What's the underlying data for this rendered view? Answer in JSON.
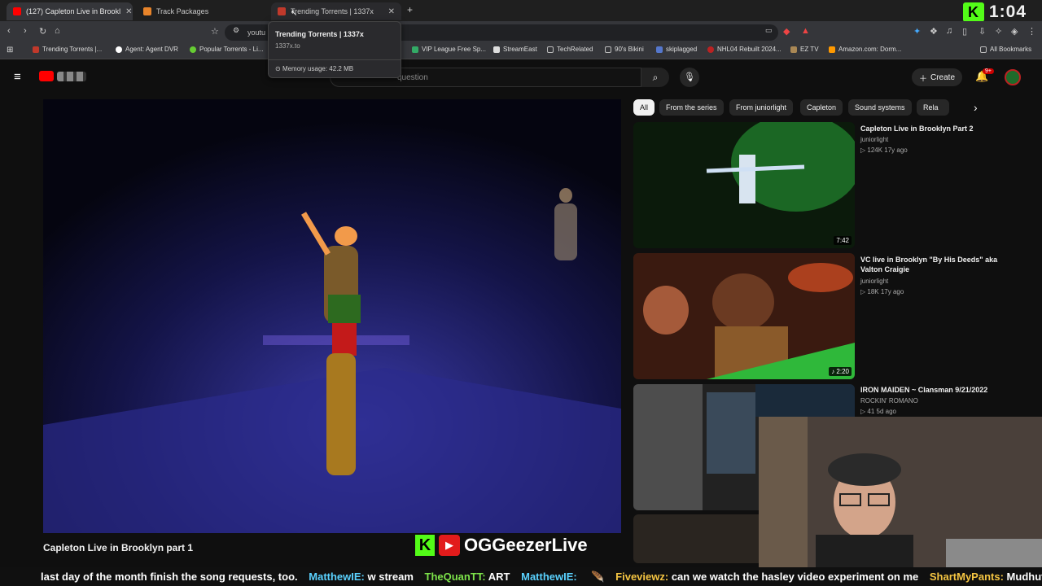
{
  "browser": {
    "tabs": [
      {
        "title": "(127) Capleton Live in Brookl",
        "active": true
      },
      {
        "title": "Track Packages",
        "active": false
      },
      {
        "title": "Trending Torrents | 1337x",
        "active": false
      }
    ],
    "new_tab": "+",
    "address": "youtu",
    "tooltip": {
      "title": "Trending Torrents | 1337x",
      "domain": "1337x.to",
      "memory": "Memory usage: 42.2 MB"
    },
    "bookmarks": [
      "Trending Torrents |...",
      "Agent: Agent DVR",
      "Popular Torrents - Li...",
      "VIP League Free Sp...",
      "StreamEast",
      "TechRelated",
      "90's Bikini",
      "skiplagged",
      "NHL04 Rebuilt 2024...",
      "EZ TV",
      "Amazon.com: Dorm...",
      "All Bookmarks"
    ]
  },
  "youtube": {
    "search_placeholder": "question",
    "create_label": "Create",
    "notifications": "9+",
    "chips": [
      "All",
      "From the series",
      "From juniorlight",
      "Capleton",
      "Sound systems",
      "Rela"
    ],
    "video_title": "Capleton Live in Brooklyn part 1",
    "related": [
      {
        "title": "Capleton Live in Brooklyn Part 2",
        "channel": "juniorlight",
        "meta": "124K  17y ago",
        "duration": "7:42"
      },
      {
        "title": "VC live in Brooklyn \"By His Deeds\" aka Valton Craigie",
        "channel": "juniorlight",
        "meta": "18K  17y ago",
        "duration": "2:20"
      },
      {
        "title": "IRON MAIDEN ~ Clansman 9/21/2022",
        "channel": "ROCKIN' ROMANO",
        "meta": "41  5d ago",
        "duration": ""
      }
    ]
  },
  "stream": {
    "clock": "1:04",
    "brand_name": "OGGeezerLive",
    "ticker": [
      {
        "user": "",
        "text": "last day of the month finish the song requests, too."
      },
      {
        "user": "MatthewIE:",
        "text": "w stream"
      },
      {
        "user": "TheQuanTT:",
        "text": "ART"
      },
      {
        "user": "MatthewIE:",
        "text": ""
      },
      {
        "user": "Fiveviewz:",
        "text": "can we watch the hasley video experiment on me"
      },
      {
        "user": "ShartMyPants:",
        "text": "Mudhut N words"
      }
    ]
  },
  "colors": {
    "accent_red": "#ff0000",
    "kick_green": "#53fc18",
    "chip_selected": "#f1f1f1"
  }
}
